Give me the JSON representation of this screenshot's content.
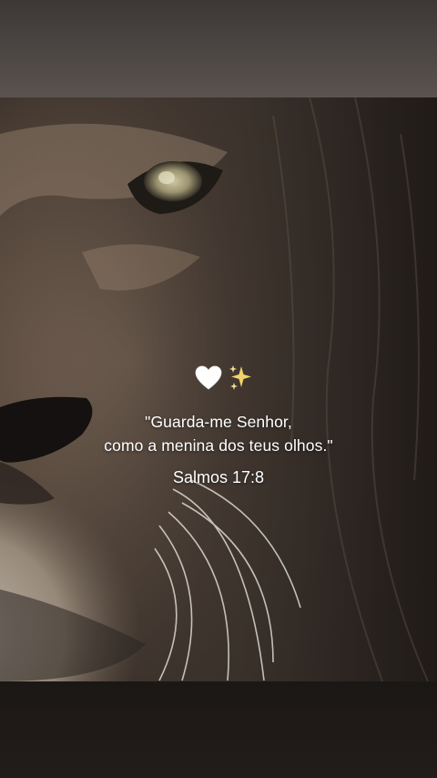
{
  "story": {
    "emojis": [
      "white-heart-icon",
      "sparkles-icon"
    ],
    "quote_line1": "\"Guarda-me Senhor,",
    "quote_line2": "como a menina dos teus olhos.\"",
    "reference": "Salmos 17:8"
  },
  "colors": {
    "top_band": "#4a4442",
    "bottom_band": "#1d1917",
    "text": "#ffffff",
    "sparkle": "#f2d36b"
  }
}
